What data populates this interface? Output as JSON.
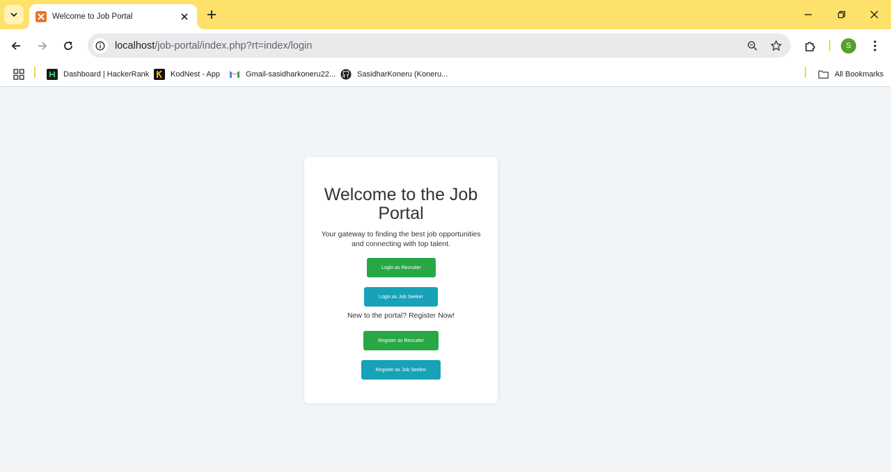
{
  "browser": {
    "tab": {
      "title": "Welcome to Job Portal"
    },
    "address": {
      "host": "localhost",
      "path": "/job-portal/index.php?rt=index/login"
    },
    "profile_initial": "S",
    "bookmarks": [
      {
        "label": "Dashboard | HackerRank",
        "icon": "hackerrank-icon"
      },
      {
        "label": "KodNest - App",
        "icon": "kodnest-icon"
      },
      {
        "label": "Gmail-sasidharkoneru22...",
        "icon": "gmail-icon"
      },
      {
        "label": "SasidharKoneru (Koneru...",
        "icon": "github-icon"
      }
    ],
    "all_bookmarks_label": "All Bookmarks"
  },
  "page": {
    "heading": "Welcome to the Job Portal",
    "lead": "Your gateway to finding the best job opportunities and connecting with top talent.",
    "login_recruiter": "Login as Recruiter",
    "login_seeker": "Login as Job Seeker",
    "register_note": "New to the portal? Register Now!",
    "register_recruiter": "Register as Recruiter",
    "register_seeker": "Register as Job Seeker"
  },
  "colors": {
    "tabstrip": "#fde16a",
    "page_background": "#f2f5f8",
    "primary_green": "#28a745",
    "info_teal": "#17a2b8"
  }
}
